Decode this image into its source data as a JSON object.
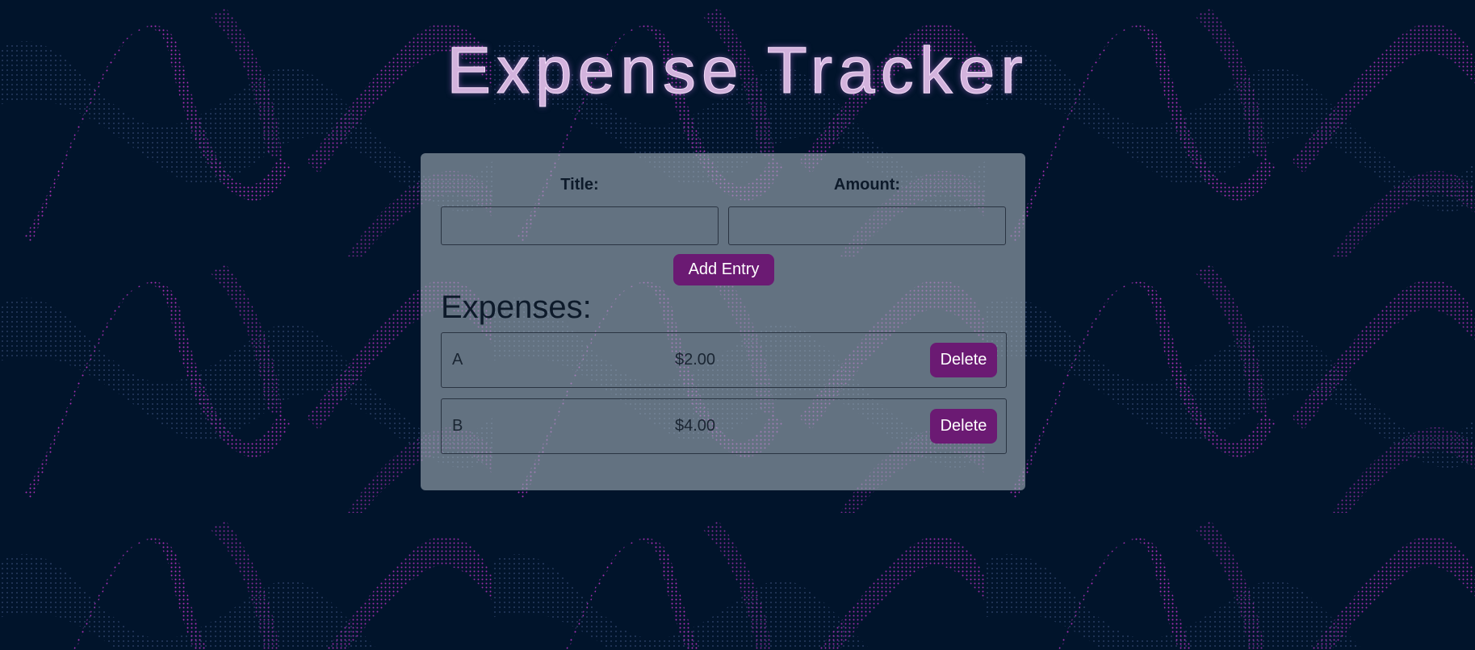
{
  "header": {
    "title": "Expense Tracker"
  },
  "form": {
    "title_label": "Title:",
    "title_value": "",
    "amount_label": "Amount:",
    "amount_value": "",
    "add_label": "Add Entry"
  },
  "expenses": {
    "heading": "Expenses:",
    "items": [
      {
        "title": "A",
        "amount": "$2.00",
        "delete_label": "Delete"
      },
      {
        "title": "B",
        "amount": "$4.00",
        "delete_label": "Delete"
      }
    ]
  },
  "colors": {
    "background": "#01142b",
    "accent": "#6b1a73",
    "title_text": "#d3b3dd",
    "wave_pink": "#c033c9",
    "wave_blue": "#5a6fa8"
  }
}
